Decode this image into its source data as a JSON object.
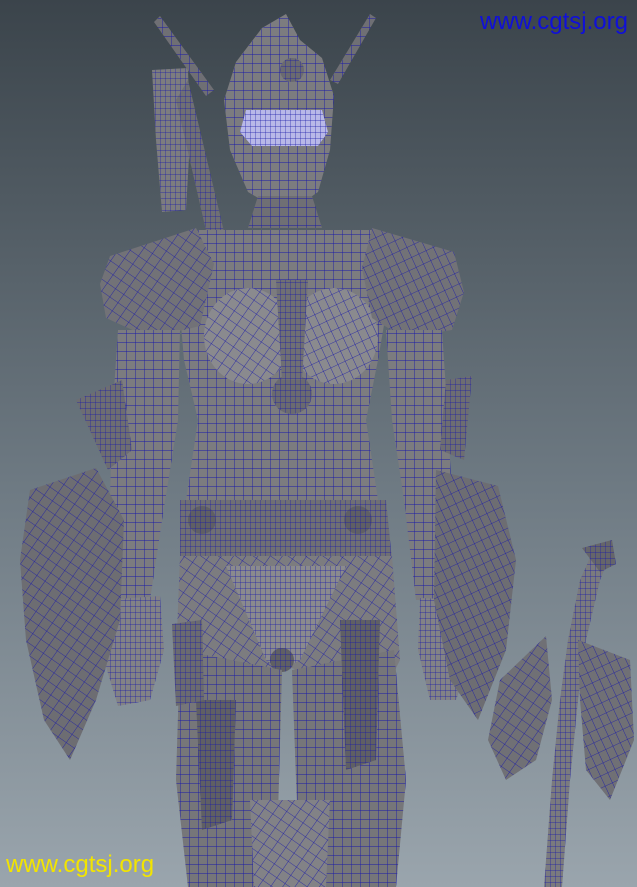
{
  "watermarks": {
    "top_right": "www.cgtsj.org",
    "bottom_left": "www.cgtsj.org"
  },
  "scene": {
    "subject": "wireframe-armored-female-warrior",
    "background_top": "#3b444b",
    "background_bottom": "#9aa5ad",
    "mesh_fill": "#7c7c7f",
    "mesh_fill_dark": "#5f5f64",
    "mesh_fill_light": "#929296",
    "wire_color": "#1a1aa8",
    "visor_color": "#b8b8e8"
  },
  "colors": {
    "watermark_top": "#1010d8",
    "watermark_bottom": "#f2e400"
  }
}
